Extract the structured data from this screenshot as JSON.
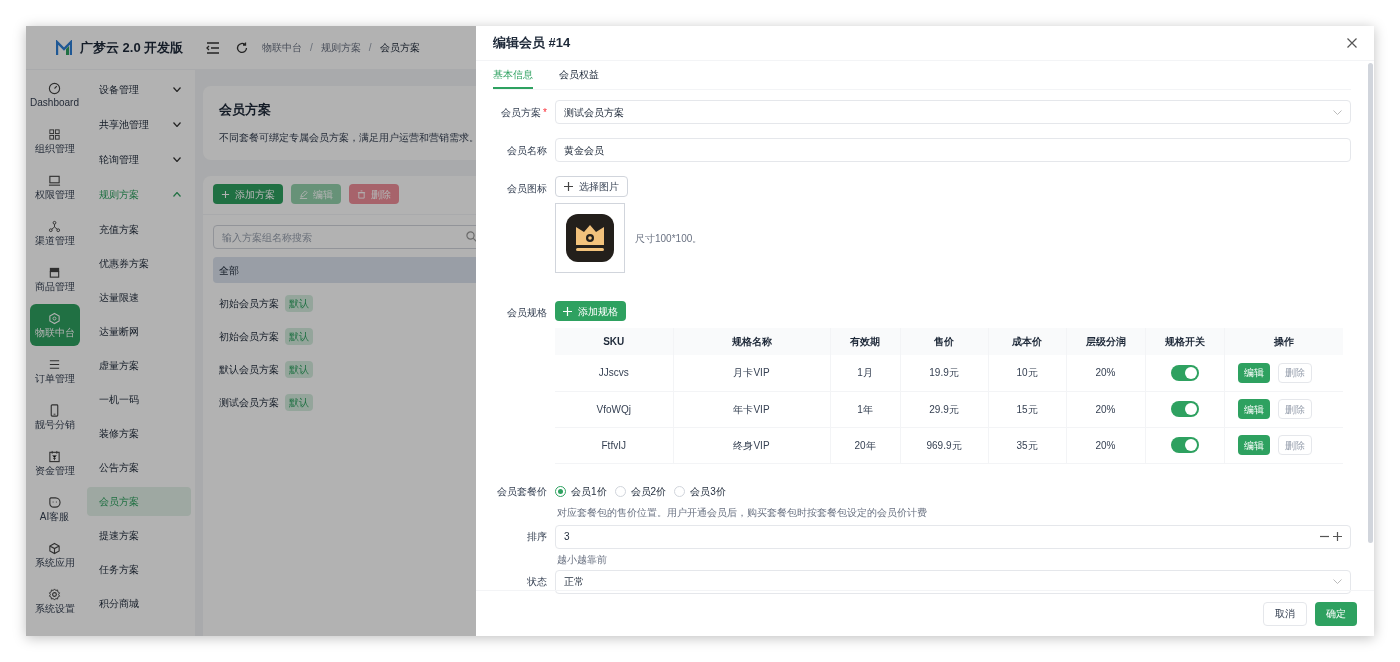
{
  "app": {
    "logo_text": "广梦云 2.0 开发版"
  },
  "breadcrumb": {
    "items": [
      "物联中台",
      "规则方案",
      "会员方案"
    ],
    "separator": "/"
  },
  "rail": [
    {
      "label": "Dashboard",
      "selected": false
    },
    {
      "label": "组织管理",
      "selected": false
    },
    {
      "label": "权限管理",
      "selected": false
    },
    {
      "label": "渠道管理",
      "selected": false
    },
    {
      "label": "商品管理",
      "selected": false
    },
    {
      "label": "物联中台",
      "selected": true
    },
    {
      "label": "订单管理",
      "selected": false
    },
    {
      "label": "靓号分销",
      "selected": false
    },
    {
      "label": "资金管理",
      "selected": false
    },
    {
      "label": "AI客服",
      "selected": false
    },
    {
      "label": "系统应用",
      "selected": false
    },
    {
      "label": "系统设置",
      "selected": false
    }
  ],
  "submenu": [
    {
      "label": "设备管理",
      "kind": "group",
      "expanded": false
    },
    {
      "label": "共享池管理",
      "kind": "group",
      "expanded": false
    },
    {
      "label": "轮询管理",
      "kind": "group",
      "expanded": false
    },
    {
      "label": "规则方案",
      "kind": "group",
      "expanded": true
    },
    {
      "label": "充值方案",
      "kind": "item",
      "selected": false
    },
    {
      "label": "优惠券方案",
      "kind": "item",
      "selected": false
    },
    {
      "label": "达量限速",
      "kind": "item",
      "selected": false
    },
    {
      "label": "达量断网",
      "kind": "item",
      "selected": false
    },
    {
      "label": "虚量方案",
      "kind": "item",
      "selected": false
    },
    {
      "label": "一机一码",
      "kind": "item",
      "selected": false
    },
    {
      "label": "装修方案",
      "kind": "item",
      "selected": false
    },
    {
      "label": "公告方案",
      "kind": "item",
      "selected": false
    },
    {
      "label": "会员方案",
      "kind": "item",
      "selected": true
    },
    {
      "label": "提速方案",
      "kind": "item",
      "selected": false
    },
    {
      "label": "任务方案",
      "kind": "item",
      "selected": false
    },
    {
      "label": "积分商城",
      "kind": "item",
      "selected": false
    }
  ],
  "page": {
    "title": "会员方案",
    "description": "不同套餐可绑定专属会员方案，满足用户运营和营销需求。",
    "toolbar": [
      {
        "label": "添加方案",
        "kind": "add"
      },
      {
        "label": "编辑",
        "kind": "edit"
      },
      {
        "label": "删除",
        "kind": "delete"
      }
    ],
    "search": {
      "placeholder": "输入方案组名称搜索"
    },
    "list": [
      {
        "label": "全部",
        "selected": true
      },
      {
        "label": "初始会员方案",
        "tag": "默认",
        "selected": false
      },
      {
        "label": "初始会员方案",
        "tag": "默认",
        "selected": false
      },
      {
        "label": "默认会员方案",
        "tag": "默认",
        "selected": false
      },
      {
        "label": "测试会员方案",
        "tag": "默认",
        "selected": false
      }
    ]
  },
  "drawer": {
    "title": "编辑会员 #14",
    "tabs": [
      {
        "label": "基本信息",
        "selected": true
      },
      {
        "label": "会员权益",
        "selected": false
      }
    ],
    "fields": [
      {
        "label": "会员方案",
        "required_mark": "*",
        "kind": "select",
        "value": "测试会员方案"
      },
      {
        "label": "会员名称",
        "kind": "text",
        "value": "黄金会员"
      }
    ],
    "icon_field": {
      "label": "会员图标",
      "button": "选择图片",
      "hint": "尺寸100*100。"
    },
    "specs": {
      "label": "会员规格",
      "button": "添加规格",
      "columns": [
        "SKU",
        "规格名称",
        "有效期",
        "售价",
        "成本价",
        "层级分润",
        "规格开关",
        "操作"
      ],
      "rows": [
        {
          "cells": [
            "JJscvs",
            "月卡VIP",
            "1月",
            "19.9元",
            "10元",
            "20%"
          ],
          "on": true,
          "actions": [
            "编辑",
            "删除"
          ]
        },
        {
          "cells": [
            "VfoWQj",
            "年卡VIP",
            "1年",
            "29.9元",
            "15元",
            "20%"
          ],
          "on": true,
          "actions": [
            "编辑",
            "删除"
          ]
        },
        {
          "cells": [
            "FtfvIJ",
            "终身VIP",
            "20年",
            "969.9元",
            "35元",
            "20%"
          ],
          "on": true,
          "actions": [
            "编辑",
            "删除"
          ]
        }
      ]
    },
    "price": {
      "label": "会员套餐价",
      "options": [
        {
          "label": "会员1价",
          "selected": true
        },
        {
          "label": "会员2价",
          "selected": false
        },
        {
          "label": "会员3价",
          "selected": false
        }
      ],
      "help": "对应套餐包的售价位置。用户开通会员后，购买套餐包时按套餐包设定的会员价计费"
    },
    "sort": {
      "label": "排序",
      "value": "3",
      "help": "越小越靠前"
    },
    "status": {
      "label": "状态",
      "value": "正常"
    },
    "footer": [
      {
        "label": "取消",
        "kind": "secondary"
      },
      {
        "label": "确定",
        "kind": "primary"
      }
    ]
  }
}
